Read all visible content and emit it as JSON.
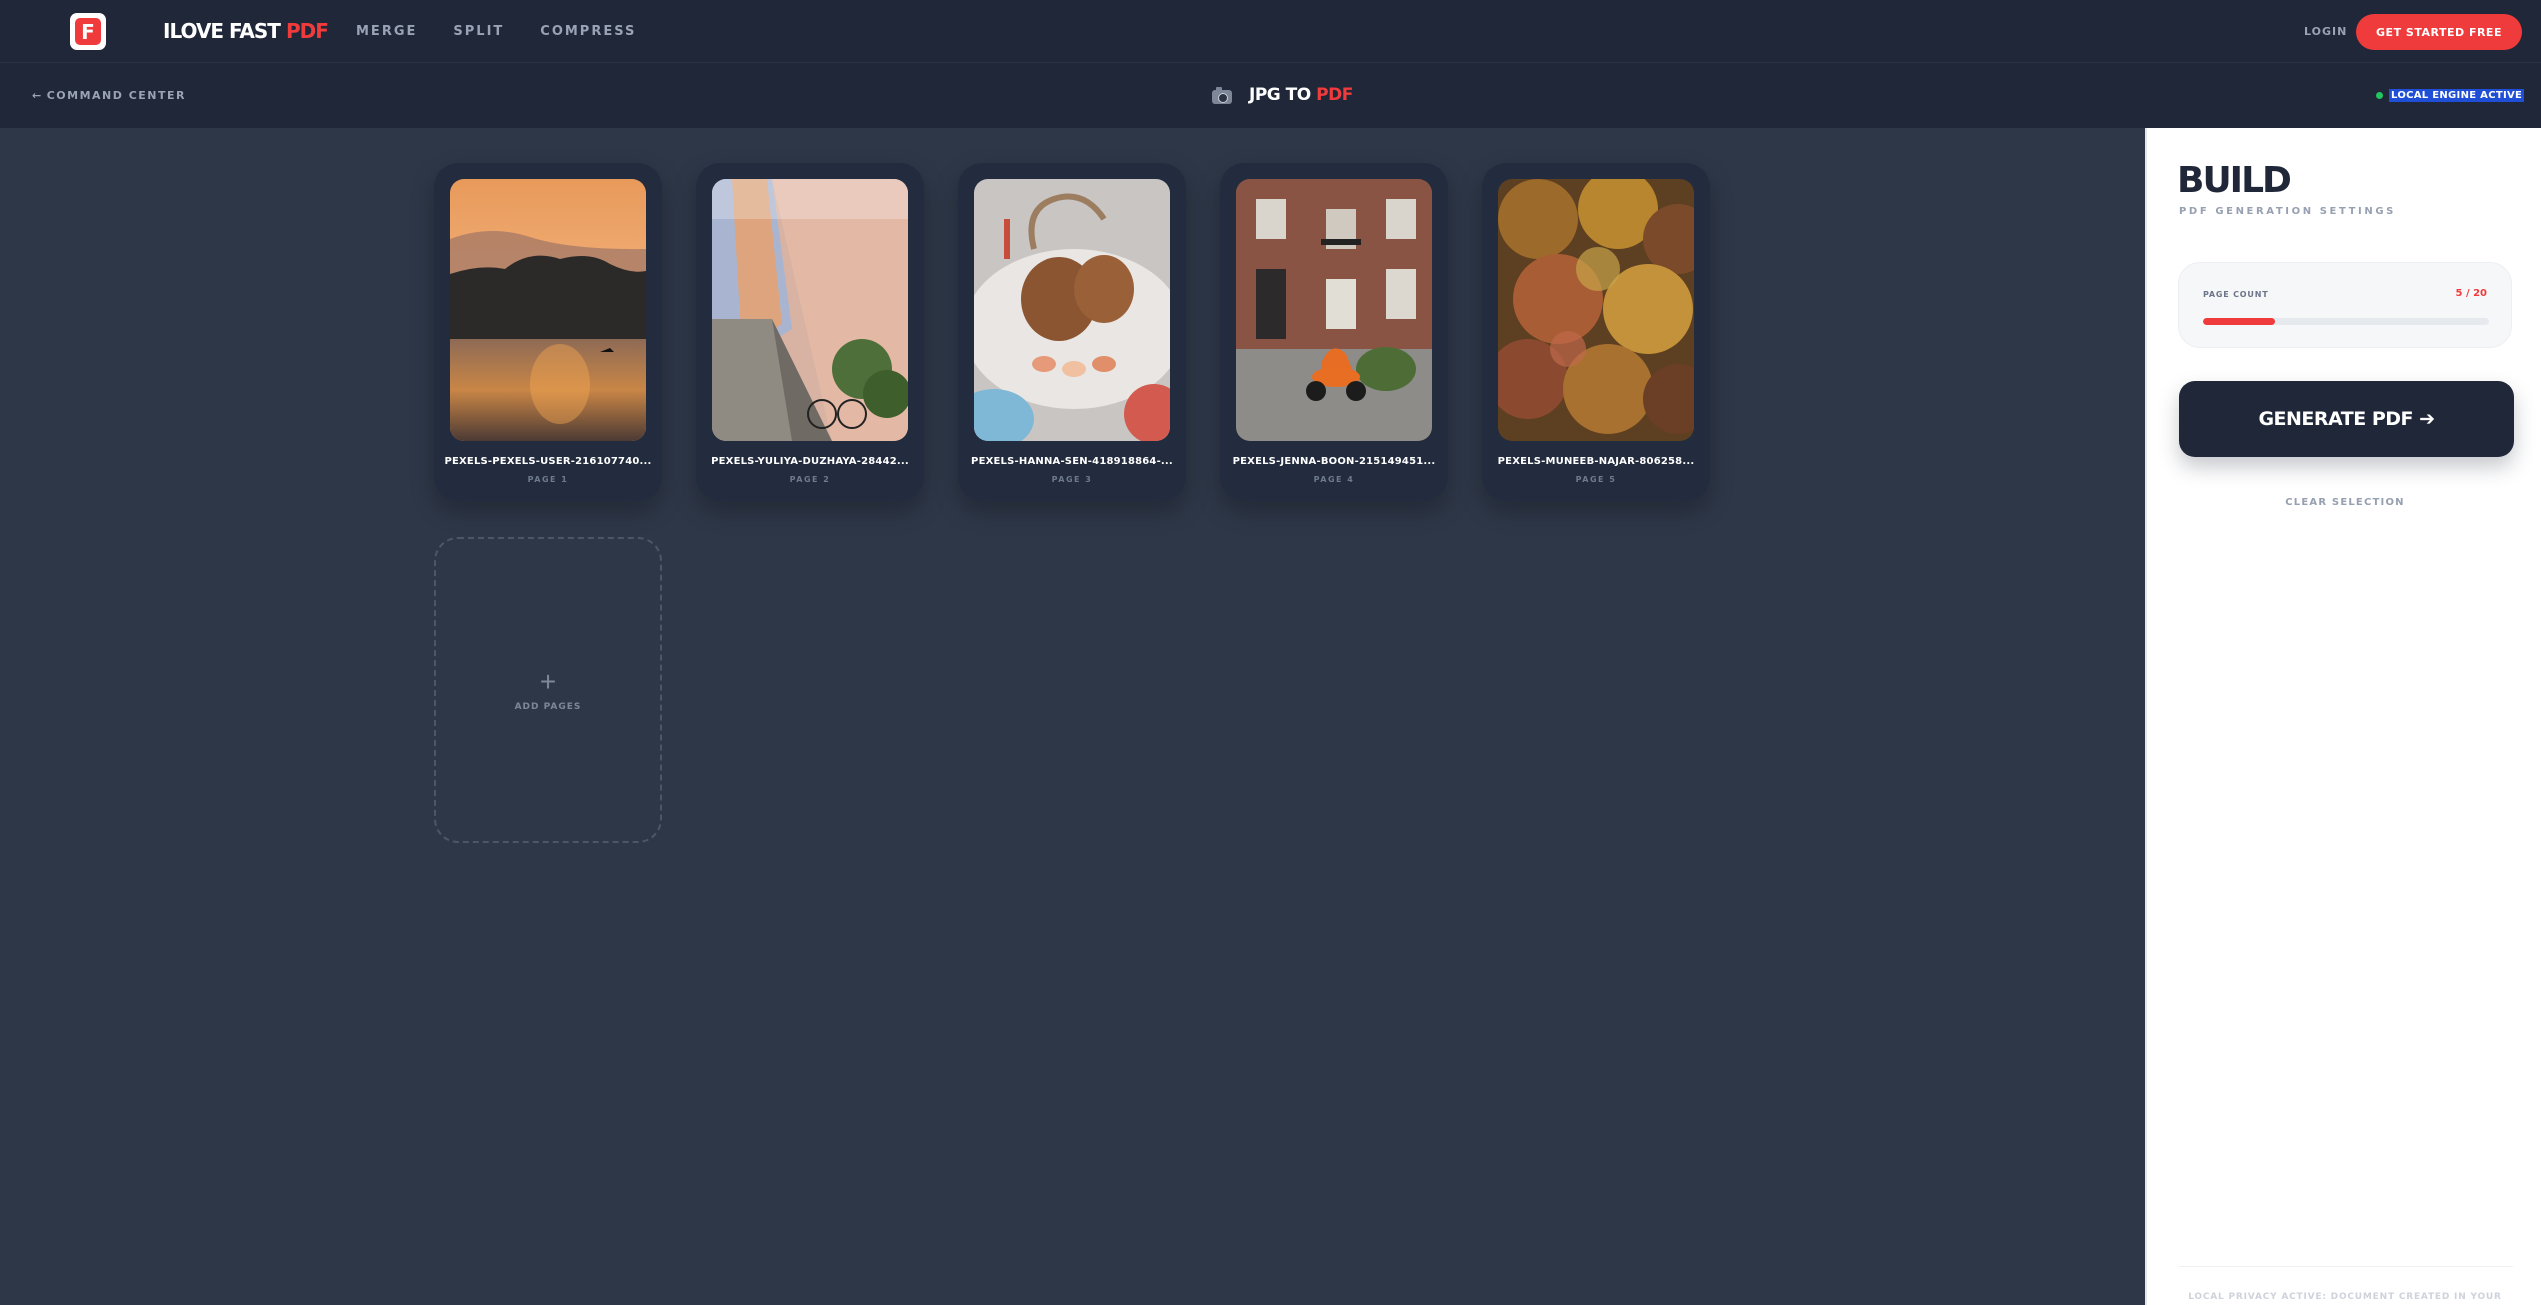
{
  "nav": {
    "logo_letter": "F",
    "brand_main": "ILOVE FAST",
    "brand_accent": "PDF",
    "links": [
      "MERGE",
      "SPLIT",
      "COMPRESS"
    ],
    "login": "LOGIN",
    "cta": "GET STARTED FREE"
  },
  "subheader": {
    "back_arrow": "←",
    "back_label": "COMMAND CENTER",
    "tool_main": "JPG TO",
    "tool_accent": "PDF",
    "engine_status": "LOCAL ENGINE ACTIVE"
  },
  "pages": [
    {
      "filename": "PEXELS-PEXELS-USER-216107740...",
      "page_label": "PAGE 1"
    },
    {
      "filename": "PEXELS-YULIYA-DUZHAYA-28442...",
      "page_label": "PAGE 2"
    },
    {
      "filename": "PEXELS-HANNA-SEN-418918864-...",
      "page_label": "PAGE 3"
    },
    {
      "filename": "PEXELS-JENNA-BOON-215149451...",
      "page_label": "PAGE 4"
    },
    {
      "filename": "PEXELS-MUNEEB-NAJAR-806258...",
      "page_label": "PAGE 5"
    }
  ],
  "add_card": {
    "plus": "+",
    "label": "ADD PAGES"
  },
  "panel": {
    "title": "BUILD",
    "subtitle": "PDF GENERATION SETTINGS",
    "page_count_label": "PAGE COUNT",
    "page_count_value": "5 / 20",
    "page_count_fraction": 0.25,
    "generate_label": "GENERATE PDF ➔",
    "clear_label": "CLEAR SELECTION",
    "footer_note": "LOCAL PRIVACY ACTIVE: DOCUMENT CREATED IN YOUR"
  },
  "colors": {
    "accent": "#ef3b3b",
    "background": "#2e3748",
    "header": "#1f2738",
    "engine_dot": "#22c55e"
  }
}
